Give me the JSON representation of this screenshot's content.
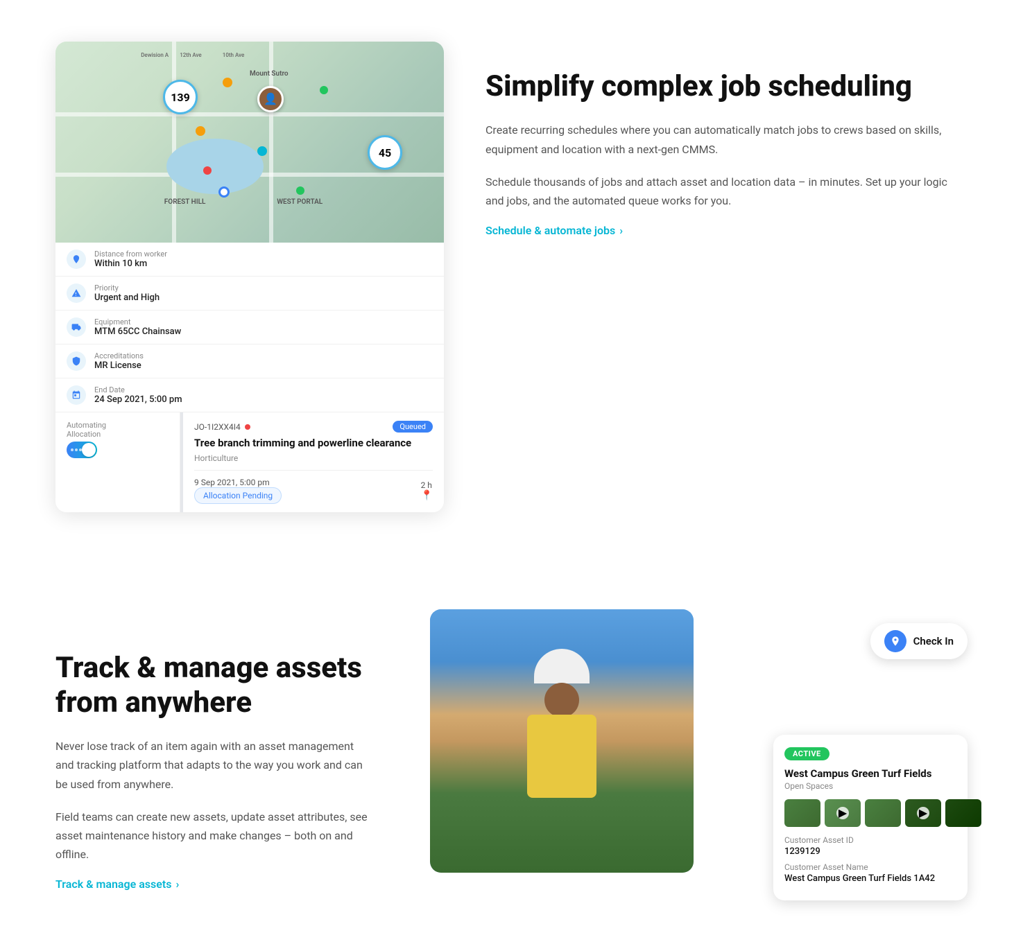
{
  "section1": {
    "map": {
      "badge1": "139",
      "badge2": "45",
      "label1": "MOUNT SUTRO",
      "label2": "FOREST HILL",
      "label3": "WEST PORTAL"
    },
    "filters": [
      {
        "id": "distance",
        "label": "Distance from worker",
        "value": "Within 10 km"
      },
      {
        "id": "priority",
        "label": "Priority",
        "value": "Urgent and High"
      },
      {
        "id": "equipment",
        "label": "Equipment",
        "value": "MTM 65CC Chainsaw"
      },
      {
        "id": "accreditations",
        "label": "Accreditations",
        "value": "MR License"
      },
      {
        "id": "enddate",
        "label": "End Date",
        "value": "24 Sep 2021, 5:00 pm"
      }
    ],
    "automating": {
      "label": "Automating\nAllocation"
    },
    "job": {
      "id": "JO-1I2XX4I4",
      "status": "Queued",
      "title": "Tree branch trimming and powerline clearance",
      "category": "Horticulture",
      "date": "9 Sep 2021, 5:00 pm",
      "duration": "2 h",
      "allocation": "Allocation Pending"
    },
    "heading": "Simplify complex job scheduling",
    "para1": "Create recurring schedules where you can automatically match jobs to crews based on skills, equipment and location with a next-gen CMMS.",
    "para2": "Schedule thousands of jobs and attach asset and location data – in minutes. Set up your logic and jobs, and the automated queue works for you.",
    "cta": "Schedule & automate jobs"
  },
  "section2": {
    "heading": "Track & manage assets from anywhere",
    "para1": "Never lose track of an item again with an asset management and tracking platform that adapts to the way you work and can be used from anywhere.",
    "para2": "Field teams can create new assets, update asset attributes, see asset maintenance history and make changes – both on and offline.",
    "cta": "Track & manage assets",
    "checkin": "Check In",
    "asset": {
      "status": "ACTIVE",
      "name": "West Campus Green Turf Fields",
      "type": "Open Spaces",
      "customerAssetIdLabel": "Customer Asset ID",
      "customerAssetId": "1239129",
      "customerAssetNameLabel": "Customer Asset Name",
      "customerAssetName": "West Campus Green Turf Fields 1A42"
    }
  }
}
